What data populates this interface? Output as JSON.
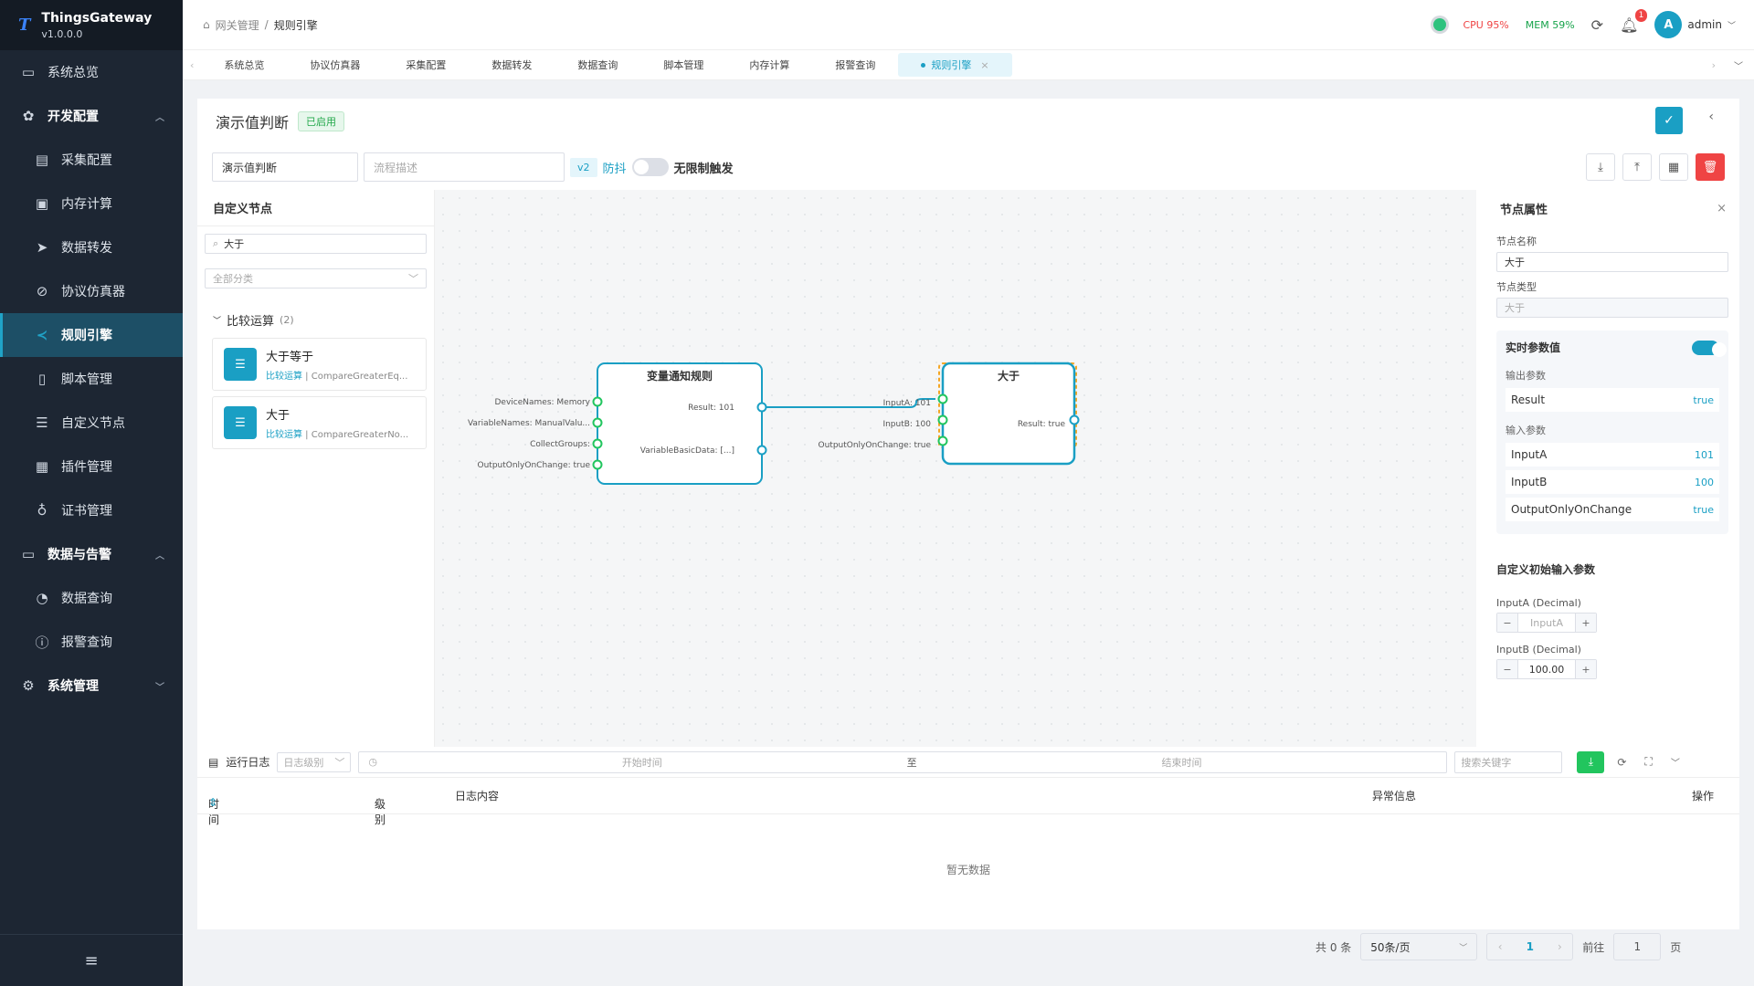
{
  "app": {
    "name": "ThingsGateway",
    "version": "v1.0.0.0"
  },
  "sidebar": {
    "items": [
      {
        "label": "系统总览",
        "icon": "monitor-icon"
      },
      {
        "label": "开发配置",
        "icon": "gear-icon"
      },
      {
        "label": "采集配置",
        "icon": "chart-icon"
      },
      {
        "label": "内存计算",
        "icon": "chip-icon"
      },
      {
        "label": "数据转发",
        "icon": "send-icon"
      },
      {
        "label": "协议仿真器",
        "icon": "link-icon"
      },
      {
        "label": "规则引擎",
        "icon": "share-icon"
      },
      {
        "label": "脚本管理",
        "icon": "file-icon"
      },
      {
        "label": "自定义节点",
        "icon": "sliders-icon"
      },
      {
        "label": "插件管理",
        "icon": "plugin-icon"
      },
      {
        "label": "证书管理",
        "icon": "cert-icon"
      },
      {
        "label": "数据与告警",
        "icon": "alert-icon"
      },
      {
        "label": "数据查询",
        "icon": "gauge-icon"
      },
      {
        "label": "报警查询",
        "icon": "warn-icon"
      },
      {
        "label": "系统管理",
        "icon": "settings-icon"
      }
    ]
  },
  "header": {
    "breadcrumb": [
      "网关管理",
      "规则引擎"
    ],
    "cpu": "CPU 95%",
    "mem": "MEM 59%",
    "notifications": "1",
    "avatar": "A",
    "user": "admin"
  },
  "tabs": [
    "系统总览",
    "协议仿真器",
    "采集配置",
    "数据转发",
    "数据查询",
    "脚本管理",
    "内存计算",
    "报警查询",
    "规则引擎"
  ],
  "editor": {
    "title": "演示值判断",
    "status": "已启用",
    "name_value": "演示值判断",
    "desc_placeholder": "流程描述",
    "version": "v2",
    "debounce": "防抖",
    "unlimited": "无限制触发"
  },
  "nodes_panel": {
    "title": "自定义节点",
    "search_value": "大于",
    "category_placeholder": "全部分类",
    "category": "比较运算",
    "category_count": "(2)",
    "items": [
      {
        "name": "大于等于",
        "cat": "比较运算",
        "cls": "CompareGreaterEq..."
      },
      {
        "name": "大于",
        "cat": "比较运算",
        "cls": "CompareGreaterNo..."
      }
    ]
  },
  "graph": {
    "node1": {
      "title": "变量通知规则",
      "inputs": [
        "DeviceNames: Memory",
        "VariableNames: ManualValu...",
        "CollectGroups:",
        "OutputOnlyOnChange: true"
      ],
      "outputs": [
        "Result: 101",
        "VariableBasicData: [...]"
      ]
    },
    "node2": {
      "title": "大于",
      "inputs": [
        "InputA: 101",
        "InputB: 100",
        "OutputOnlyOnChange: true"
      ],
      "outputs": [
        "Result: true"
      ]
    }
  },
  "props": {
    "title": "节点属性",
    "name_label": "节点名称",
    "name_value": "大于",
    "type_label": "节点类型",
    "type_value": "大于",
    "realtime_title": "实时参数值",
    "out_label": "输出参数",
    "outputs": [
      {
        "k": "Result",
        "v": "true"
      }
    ],
    "in_label": "输入参数",
    "inputs": [
      {
        "k": "InputA",
        "v": "101"
      },
      {
        "k": "InputB",
        "v": "100"
      },
      {
        "k": "OutputOnlyOnChange",
        "v": "true"
      }
    ],
    "custom_title": "自定义初始输入参数",
    "inputA_label": "InputA (Decimal)",
    "inputA_placeholder": "InputA",
    "inputB_label": "InputB (Decimal)",
    "inputB_value": "100.00"
  },
  "logs": {
    "title": "运行日志",
    "level_placeholder": "日志级别",
    "start_placeholder": "开始时间",
    "to": "至",
    "end_placeholder": "结束时间",
    "search_placeholder": "搜索关键字",
    "columns": [
      "时间",
      "级别",
      "日志内容",
      "异常信息",
      "操作"
    ],
    "empty": "暂无数据"
  },
  "pager": {
    "total": "共 0 条",
    "size": "50条/页",
    "page": "1",
    "goto": "前往",
    "goto_value": "1",
    "unit": "页"
  },
  "colors": {
    "accent": "#1a9fc4",
    "sidebar": "#1d2633",
    "danger": "#ef4444",
    "success": "#22c55e"
  }
}
